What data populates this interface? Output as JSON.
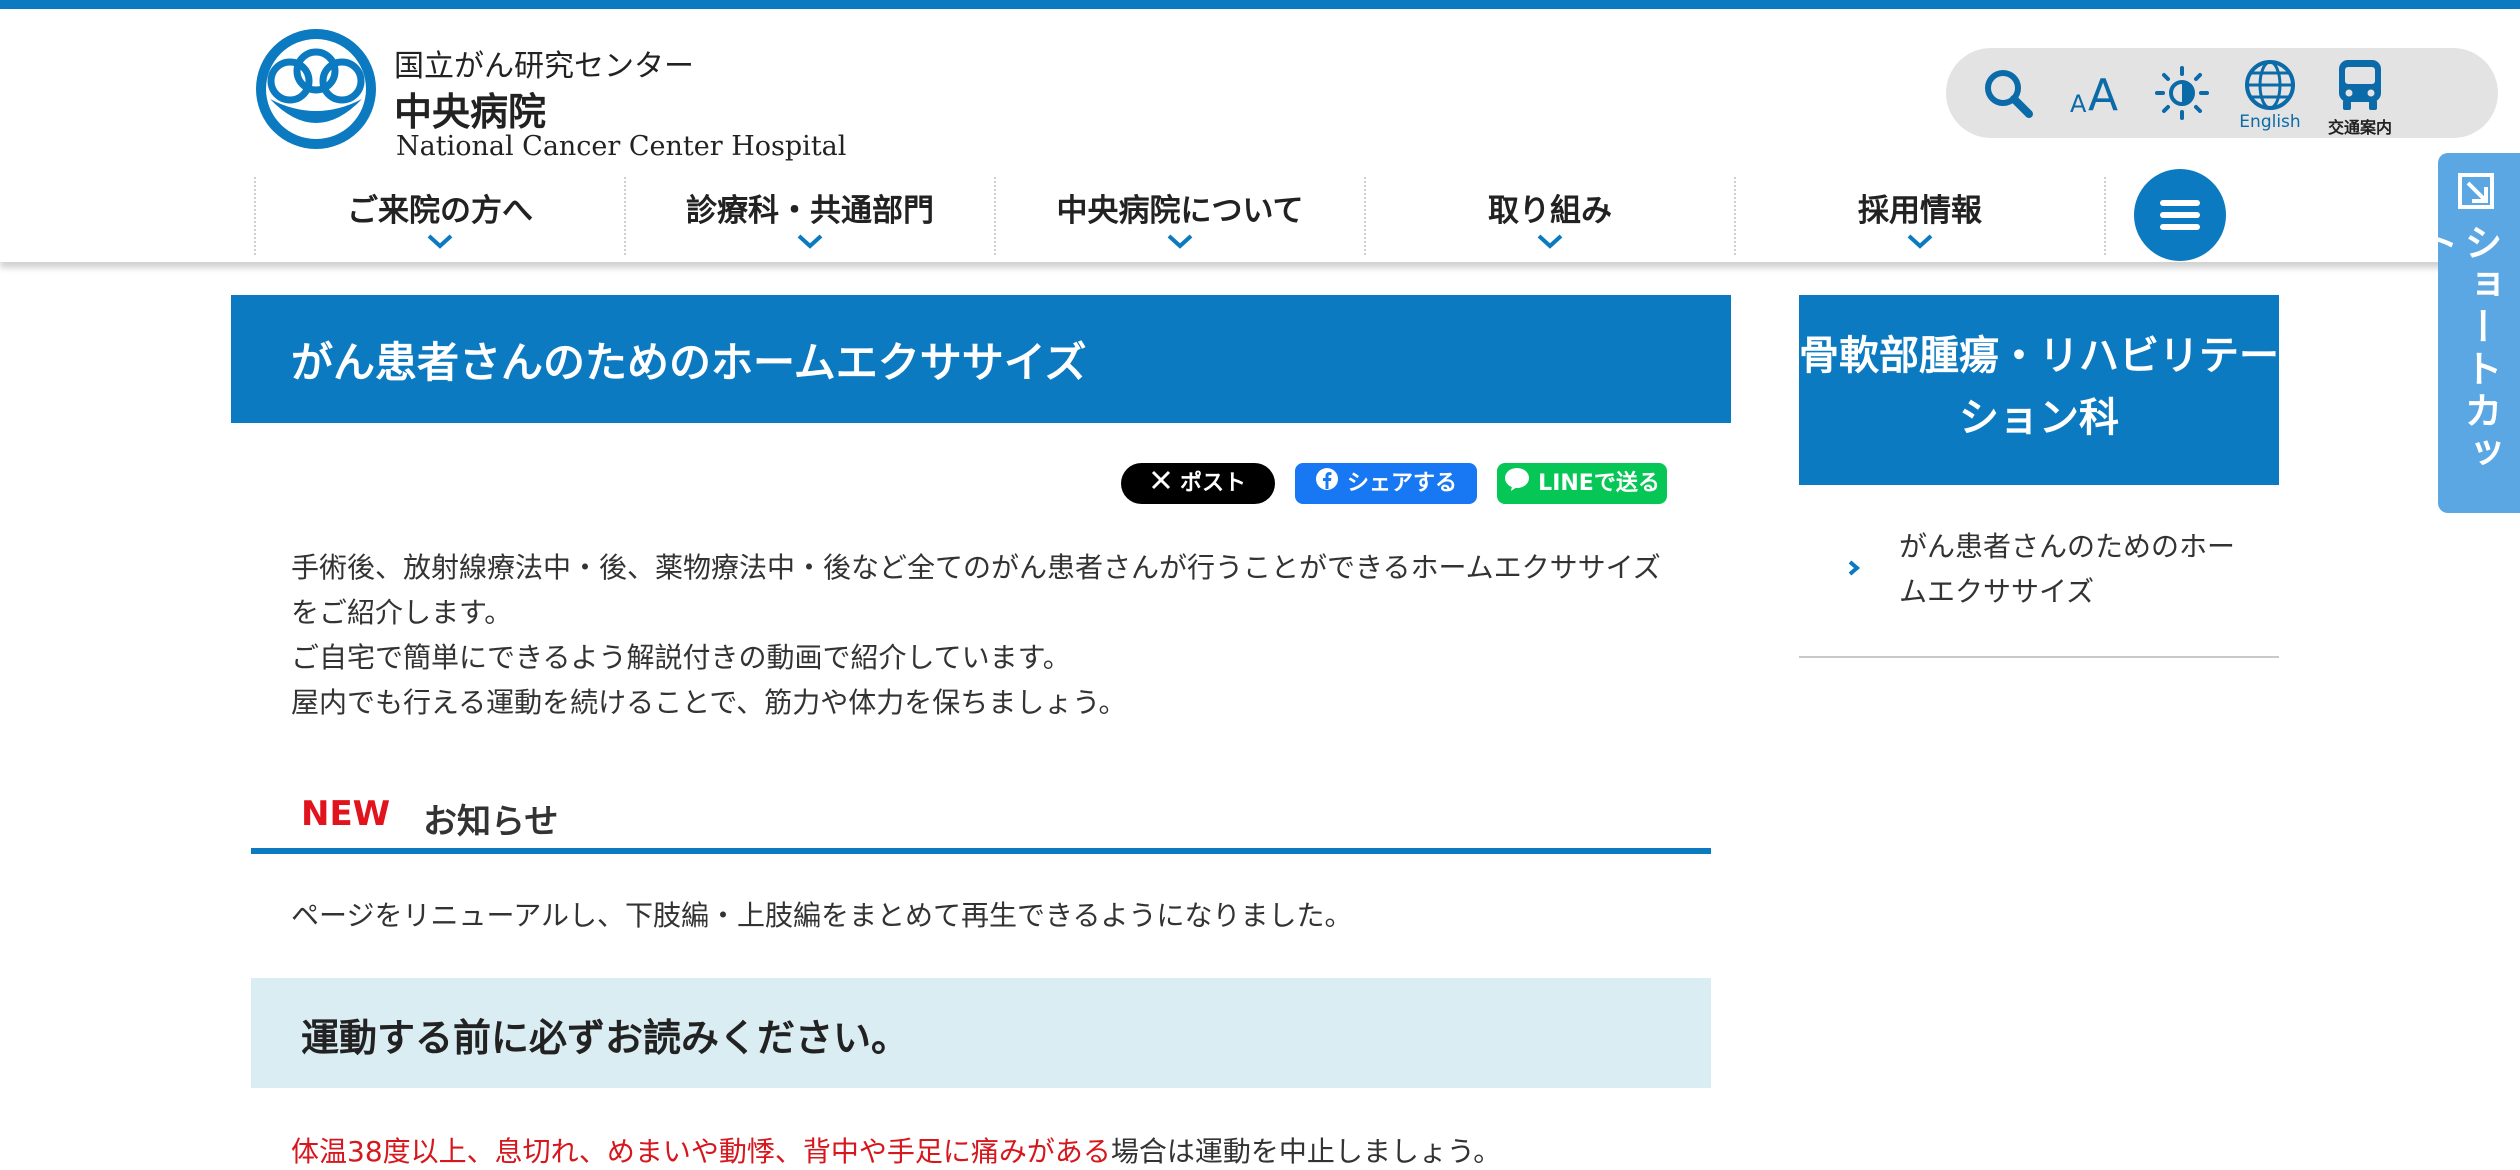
{
  "header": {
    "org_line": "国立がん研究センター",
    "hospital_name": "中央病院",
    "hospital_name_en": "National Cancer Center Hospital",
    "tools": {
      "search_icon": "search-icon",
      "font_size_icon": "font-size-icon",
      "contrast_icon": "brightness-icon",
      "english_label": "English",
      "access_label": "交通案内"
    },
    "nav": [
      {
        "label": "ご来院の方へ"
      },
      {
        "label": "診療科・共通部門"
      },
      {
        "label": "中央病院について"
      },
      {
        "label": "取り組み"
      },
      {
        "label": "採用情報"
      }
    ],
    "menu_icon": "hamburger-icon"
  },
  "shortcut": {
    "label": "ショートカット"
  },
  "main": {
    "title": "がん患者さんのためのホームエクササイズ",
    "share": {
      "x_label": "ポスト",
      "facebook_label": "シェアする",
      "line_label": "LINEで送る"
    },
    "intro": [
      "手術後、放射線療法中・後、薬物療法中・後など全てのがん患者さんが行うことができるホームエクササイズをご紹介します。",
      "ご自宅で簡単にできるよう解説付きの動画で紹介しています。",
      "屋内でも行える運動を続けることで、筋力や体力を保ちましょう。"
    ],
    "news": {
      "badge": "NEW",
      "title": "お知らせ",
      "text": "ページをリニューアルし、下肢編・上肢編をまとめて再生できるようになりました。"
    },
    "notice": {
      "title": "運動する前に必ずお読みください。"
    },
    "warning": {
      "red_text": "体温38度以上、息切れ、めまいや動悸、背中や手足に痛みがある",
      "rest": "場合は運動を中止しましょう。"
    }
  },
  "sidebar": {
    "title": "骨軟部腫瘍・リハビリテーション科",
    "links": [
      {
        "label": "がん患者さんのためのホームエクササイズ"
      }
    ]
  },
  "colors": {
    "brand": "#0b7ac0",
    "shortcut": "#5ba7e3",
    "notice_bg": "#daedf3",
    "alert": "#d6171d"
  }
}
